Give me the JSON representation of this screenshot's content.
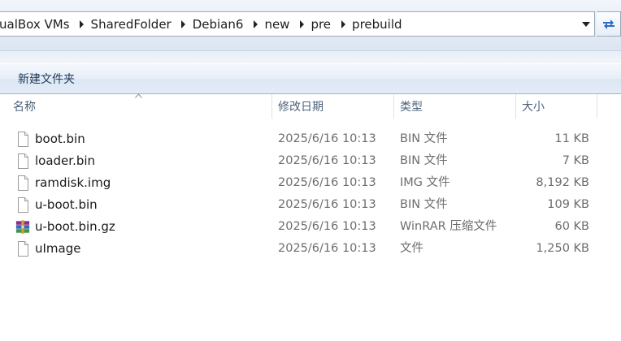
{
  "address_bar": {
    "path": [
      "ualBox VMs",
      "SharedFolder",
      "Debian6",
      "new",
      "pre",
      "prebuild"
    ]
  },
  "toolbar": {
    "new_folder_label": "新建文件夹"
  },
  "columns": {
    "name": "名称",
    "date": "修改日期",
    "type": "类型",
    "size": "大小"
  },
  "files": [
    {
      "name": "boot.bin",
      "date": "2025/6/16 10:13",
      "type": "BIN 文件",
      "size": "11 KB",
      "icon": "file-icon"
    },
    {
      "name": "loader.bin",
      "date": "2025/6/16 10:13",
      "type": "BIN 文件",
      "size": "7 KB",
      "icon": "file-icon"
    },
    {
      "name": "ramdisk.img",
      "date": "2025/6/16 10:13",
      "type": "IMG 文件",
      "size": "8,192 KB",
      "icon": "file-icon"
    },
    {
      "name": "u-boot.bin",
      "date": "2025/6/16 10:13",
      "type": "BIN 文件",
      "size": "109 KB",
      "icon": "file-icon"
    },
    {
      "name": "u-boot.bin.gz",
      "date": "2025/6/16 10:13",
      "type": "WinRAR 压缩文件",
      "size": "60 KB",
      "icon": "winrar-archive-icon"
    },
    {
      "name": "uImage",
      "date": "2025/6/16 10:13",
      "type": "文件",
      "size": "1,250 KB",
      "icon": "file-icon"
    }
  ],
  "colors": {
    "header_text": "#4c607a",
    "detail_text": "#6d6d6d",
    "toolbar_text": "#1e395b"
  }
}
